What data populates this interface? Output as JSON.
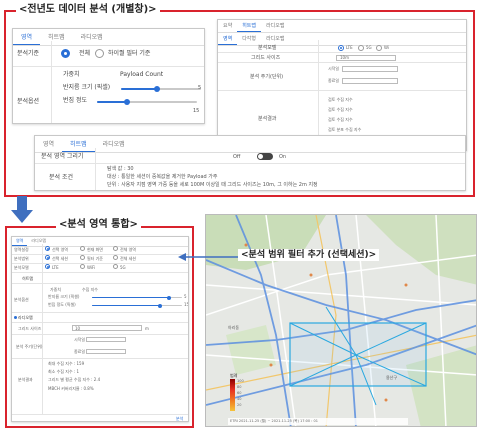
{
  "annotations": {
    "top": "<전년도 데이터 분석 (개별창)>",
    "left": "<분석 영역 통합>",
    "right": "<분석 범위 필터 추가 (선택세션)>"
  },
  "colors": {
    "frame_red": "#d9232d",
    "accent_blue": "#2a6fd6",
    "arrow_blue": "#3f6fbf",
    "map_road": "#5b8fe0",
    "map_highlight": "#29a8e0"
  },
  "panel_a": {
    "tabs": [
      "영역",
      "히트맵",
      "라디오맵"
    ],
    "row1_label": "분석기준",
    "radio1": "전체",
    "radio2": "하이퀄 필터 기준",
    "row2_label": "분석옵션",
    "sub_header": "가중치",
    "sub_header2": "Payload Count",
    "slider1_label": "반지름 크기 (픽셀)",
    "slider1_value": "5",
    "slider1_level": 0.45,
    "slider2_label": "번짐 정도",
    "slider2_value": "15",
    "slider2_level": 0.3
  },
  "panel_b": {
    "tabs": [
      "요약",
      "히트맵",
      "라디오맵"
    ],
    "subtabs": [
      "영역",
      "다각형",
      "라디오맵"
    ],
    "rows": [
      {
        "label": "분석모델",
        "values": [
          "LTE",
          "5G",
          "Wi"
        ]
      },
      {
        "label": "그리드 사이즈",
        "values": [
          "10m"
        ]
      },
      {
        "label": "분석 주기(단위)",
        "values": [
          "시작일",
          "종료일"
        ]
      },
      {
        "label": "분석결과",
        "values": [
          "검토 수집 지수",
          "검토 수집 지수",
          "검토 수집 지수",
          "검토 분포 수집 지수",
          "MBCH 커버리지율"
        ]
      }
    ]
  },
  "panel_c": {
    "tabs": [
      "영역",
      "히트맵",
      "라디오맵"
    ],
    "toggle_label": "분석 영역 그리기",
    "toggle_off": "Off",
    "toggle_on": "On",
    "cond_label": "분석 조건",
    "cond_lines": [
      "탐색 값 : 30",
      "대상 : 통일한 세션이 중복값을 제거한 Payload 가주",
      "단위 : 사용자 지점 영역 가중 등을 세로 100M 이상일 때 그리드 사이즈는 10m, 그 이하는 2m 지정"
    ]
  },
  "panel_d": {
    "tabs": [
      "영역",
      "라디오맵"
    ],
    "r1_label": "영역설정",
    "r1_opts": [
      "선택 영역",
      "현재 화면",
      "전체 영역"
    ],
    "r2_label": "분석범위",
    "r2_opts": [
      "선택 세션",
      "필터 기준",
      "전체 세션"
    ],
    "r3_label": "분석모델",
    "r3_opts": [
      "LTE",
      "WiFi",
      "5G"
    ],
    "heat_header": "히트맵",
    "weight_label": "가중치",
    "weight_value": "수집 지수",
    "opt_label": "분석옵션",
    "slider1_label": "반지름 크기 (픽셀)",
    "slider1_value": "5",
    "slider1_level": 0.85,
    "slider2_label": "번짐 정도 (픽셀)",
    "slider2_value": "15",
    "slider2_level": 0.75,
    "radio_header": "라디오맵",
    "grid_label": "그리드 사이즈",
    "grid_value": "10",
    "grid_unit": "m",
    "period_label": "분석 주기(단위)",
    "start_label": "시작일",
    "end_label": "종료일",
    "result_label": "분석결과",
    "result_lines": [
      "최대 수집 지수 : 159",
      "최소 수집 지수 : 1",
      "그리드 별 평균 수집 지수 : 2.4",
      "MBCH 커버리지율 : 0.8%"
    ],
    "footer_button": "분석"
  },
  "map": {
    "labels": [
      "아리동",
      "용산구",
      "서교동"
    ],
    "legend_title": "범례",
    "legend_values": [
      "100",
      "80",
      "60",
      "40",
      "20"
    ],
    "footer": "ETRI 2021-11-25 (월) ~ 2021-11-25 (목) 17:00 : 01"
  }
}
